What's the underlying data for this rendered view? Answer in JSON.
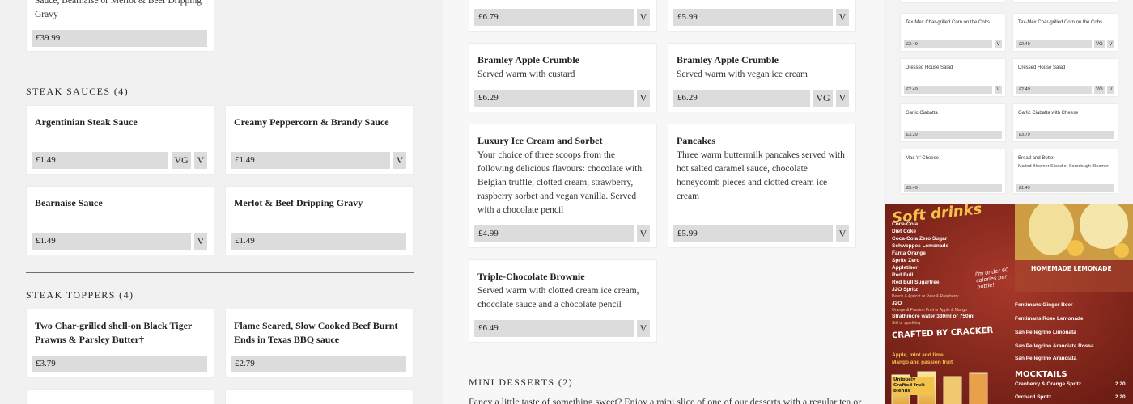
{
  "left": {
    "top_card": {
      "desc": "Sauce, Bearnaise or Merlot & Beef Dripping Gravy",
      "price": "£39.99"
    },
    "steak_sauces": {
      "heading": "STEAK SAUCES (4)",
      "items": [
        {
          "name": "Argentinian Steak Sauce",
          "price": "£1.49",
          "tags": [
            "VG",
            "V"
          ]
        },
        {
          "name": "Creamy Peppercorn & Brandy Sauce",
          "price": "£1.49",
          "tags": [
            "V"
          ]
        },
        {
          "name": "Bearnaise Sauce",
          "price": "£1.49",
          "tags": [
            "V"
          ]
        },
        {
          "name": "Merlot & Beef Dripping Gravy",
          "price": "£1.49",
          "tags": []
        }
      ]
    },
    "steak_toppers": {
      "heading": "STEAK TOPPERS (4)",
      "items": [
        {
          "name": "Two Char-grilled shell-on Black Tiger Prawns & Parsley Butter†",
          "price": "£3.79"
        },
        {
          "name": "Flame Seared, Slow Cooked Beef Burnt Ends in Texas BBQ sauce",
          "price": "£2.79"
        }
      ]
    }
  },
  "mid": {
    "row0": [
      {
        "price": "£6.79",
        "tags": [
          "V"
        ]
      },
      {
        "price": "£5.99",
        "tags": [
          "V"
        ]
      }
    ],
    "desserts": [
      {
        "name": "Bramley Apple Crumble",
        "desc": "Served warm with custard",
        "price": "£6.29",
        "tags": [
          "V"
        ]
      },
      {
        "name": "Bramley Apple Crumble",
        "desc": "Served warm with vegan ice cream",
        "price": "£6.29",
        "tags": [
          "VG",
          "V"
        ]
      },
      {
        "name": "Luxury Ice Cream and Sorbet",
        "desc": "Your choice of three scoops from the following delicious flavours: chocolate with Belgian truffle, clotted cream, strawberry, raspberry sorbet and vegan vanilla. Served with a chocolate pencil",
        "price": "£4.99",
        "tags": [
          "V"
        ]
      },
      {
        "name": "Pancakes",
        "desc": "Three warm buttermilk pancakes served with hot salted caramel sauce, chocolate honeycomb pieces and clotted cream ice cream",
        "price": "£5.99",
        "tags": [
          "V"
        ]
      },
      {
        "name": "Triple-Chocolate Brownie",
        "desc": "Served warm with clotted cream ice cream, chocolate sauce and a chocolate pencil",
        "price": "£6.49",
        "tags": [
          "V"
        ]
      }
    ],
    "mini_desserts": {
      "heading": "MINI DESSERTS (2)",
      "intro": "Fancy a little taste of something sweet? Enjoy a mini slice of one of our desserts with a regular tea or"
    }
  },
  "right": {
    "cards": [
      {
        "name": "Tex-Mex Char-grilled Corn on the Cobs",
        "desc": "",
        "price": "£2.49",
        "tags": [
          "V"
        ]
      },
      {
        "name": "Tex-Mex Char-grilled Corn on the Cobs",
        "desc": "",
        "price": "£2.49",
        "tags": [
          "VG",
          "V"
        ]
      },
      {
        "name": "Dressed House Salad",
        "desc": "",
        "price": "£2.49",
        "tags": [
          "V"
        ]
      },
      {
        "name": "Dressed House Salad",
        "desc": "",
        "price": "£2.49",
        "tags": [
          "VG",
          "V"
        ]
      },
      {
        "name": "Garlic Ciabatta",
        "desc": "",
        "price": "£3.29",
        "tags": []
      },
      {
        "name": "Garlic Ciabatta with Cheese",
        "desc": "",
        "price": "£3.79",
        "tags": []
      },
      {
        "name": "Mac 'n' Cheese",
        "desc": "",
        "price": "£3.49",
        "tags": []
      },
      {
        "name": "Bread and Butter",
        "desc": "Malted Bloomer Sliced or Sourdough Bloomer",
        "price": "£1.49",
        "tags": []
      }
    ],
    "poster": {
      "title": "Soft drinks",
      "drinks": [
        "Coca-Cola",
        "Diet Coke",
        "Coca-Cola Zero Sugar",
        "Schweppes Lemonade",
        "Fanta Orange",
        "Sprite Zero",
        "Appletiser",
        "Red Bull",
        "Red Bull Sugarfree",
        "J2O Spritz"
      ],
      "j2o_note": "Peach & Apricot or Pear & Raspberry",
      "j2o": "J2O",
      "j2o_note2": "Orange & Passion Fruit or Apple & Mango",
      "water": "Strathmore water 330ml or 750ml",
      "water_note": "Still or sparkling",
      "scribble": "I'm under 60 calories per bottle!",
      "lemonade": "HOMEMADE LEMONADE",
      "crafted": "CRAFTED BY CRACKER",
      "crafted_items": [
        "Apple, mint and lime",
        "Mango and passion fruit"
      ],
      "right_items": [
        "Fentimans Ginger Beer",
        "Fentimans Rose Lemonade",
        "San Pellegrino Limonata",
        "San Pellegrino Aranciata Rossa",
        "San Pellegrino Aranciata"
      ],
      "mocktails": "MOCKTAILS",
      "mocktail_items": [
        {
          "name": "Cranberry & Orange Spritz",
          "price": "2.20"
        },
        {
          "name": "Orchard Spritz",
          "price": "2.20"
        }
      ],
      "uniquely": "Uniquely Crafted fruit blends"
    },
    "colors": {
      "poster_bg": "#8c2a1e",
      "poster_accent": "#f3c24a"
    }
  }
}
